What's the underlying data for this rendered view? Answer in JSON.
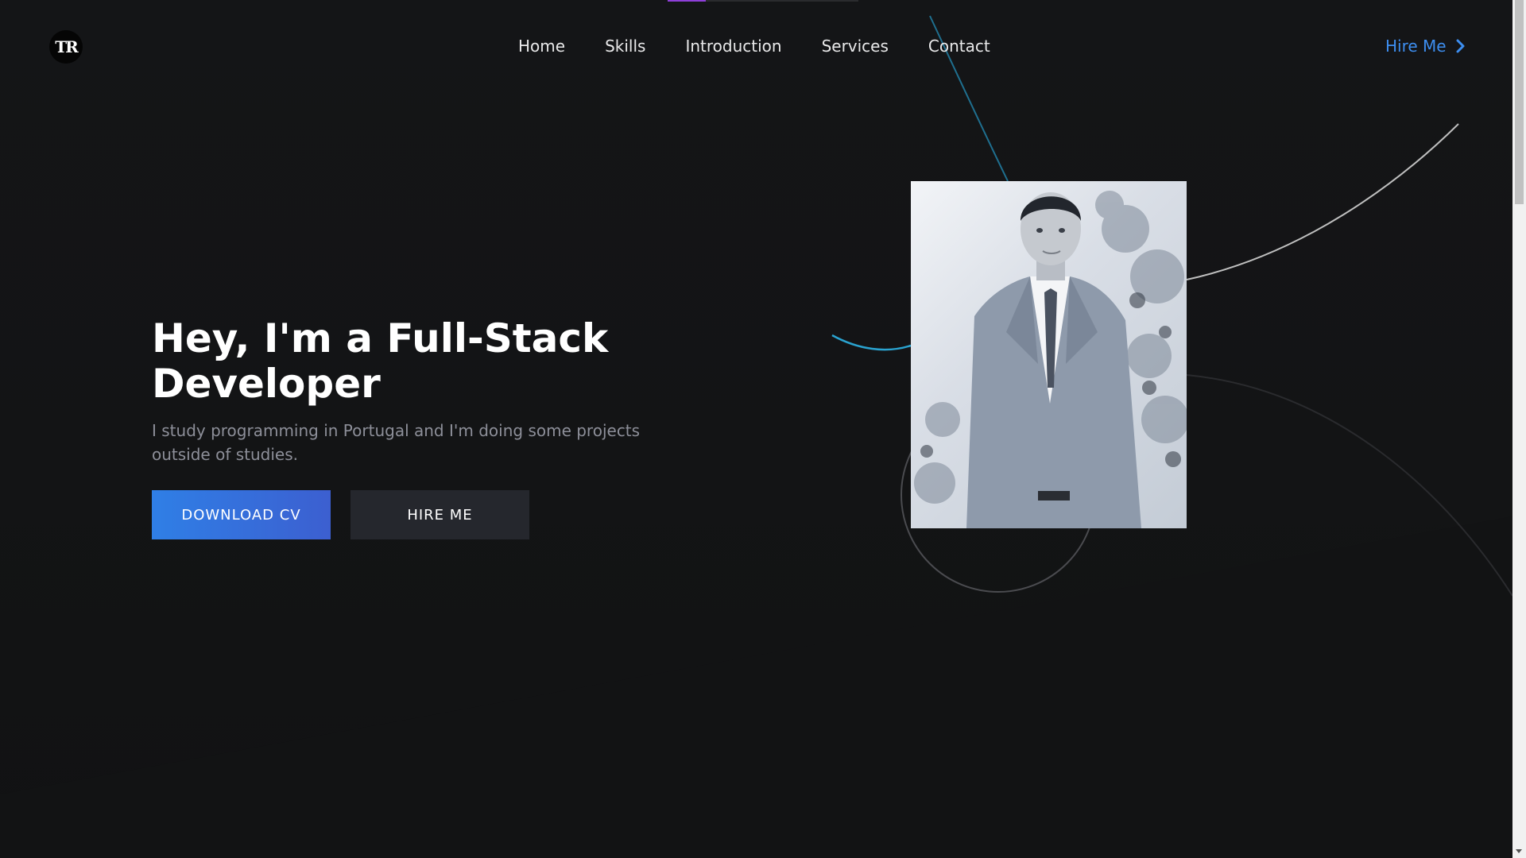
{
  "brand": {
    "logo_text": "TR"
  },
  "nav": {
    "items": [
      {
        "label": "Home"
      },
      {
        "label": "Skills"
      },
      {
        "label": "Introduction"
      },
      {
        "label": "Services"
      },
      {
        "label": "Contact"
      }
    ],
    "hire_link": "Hire Me"
  },
  "hero": {
    "title_line1": "Hey, I'm a Full-Stack",
    "title_line2": "Developer",
    "subtitle": "I study programming in Portugal and I'm doing some projects outside of studies.",
    "primary_button": "DOWNLOAD CV",
    "secondary_button": "HIRE ME"
  },
  "colors": {
    "background": "#141516",
    "accent_blue": "#3d8ef0",
    "button_primary_start": "#2f7fe6",
    "button_primary_end": "#3c5fd0",
    "button_secondary": "#25272d",
    "subtitle_gray": "#8d8f99",
    "top_accent": "#8e3fd8"
  },
  "icons": {
    "hire_link": "chevron-right-icon"
  }
}
